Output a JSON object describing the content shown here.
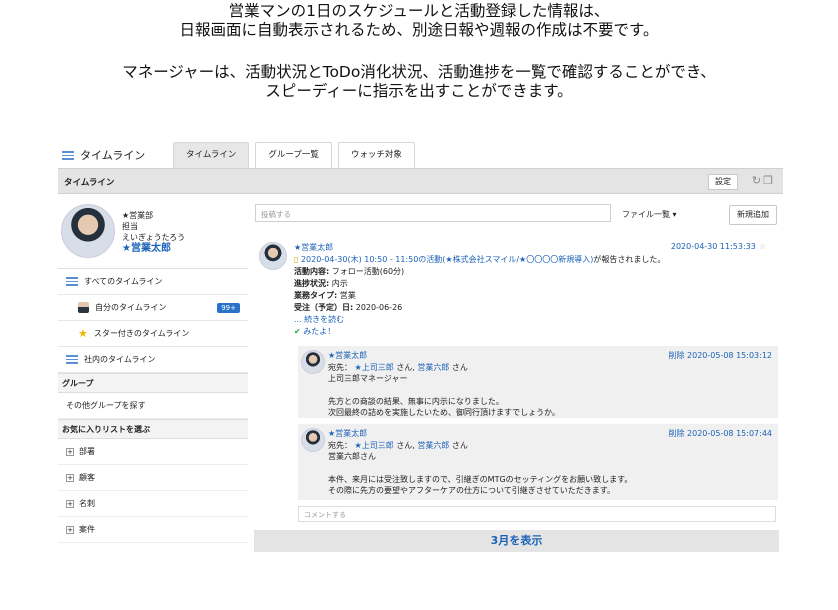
{
  "caption": {
    "line1": "営業マンの1日のスケジュールと活動登録した情報は、",
    "line2": "日報画面に自動表示されるため、別途日報や週報の作成は不要です。",
    "line3": "マネージャーは、活動状況とToDo消化状況、活動進捗を一覧で確認することができ、",
    "line4": "スピーディーに指示を出すことができます。"
  },
  "app": {
    "brand": "タイムライン",
    "tabs": [
      "タイムライン",
      "グループ一覧",
      "ウォッチ対象"
    ],
    "subbar_title": "タイムライン",
    "settings_label": "設定"
  },
  "profile": {
    "dept": "★営業部",
    "role": "担当",
    "kana": "えいぎょうたろう",
    "name": "★営業太郎"
  },
  "nav": {
    "all": "すべてのタイムライン",
    "mine": "自分のタイムライン",
    "mine_badge": "99+",
    "starred": "スター付きのタイムライン",
    "company": "社内のタイムライン"
  },
  "groups": {
    "header": "グループ",
    "find": "その他グループを探す"
  },
  "favorites": {
    "header": "お気に入りリストを選ぶ",
    "items": [
      "部署",
      "顧客",
      "名刺",
      "案件"
    ]
  },
  "main": {
    "post_placeholder": "投稿する",
    "file_list": "ファイル一覧 ▾",
    "new_button": "新規追加",
    "entry": {
      "author": "★営業太郎",
      "timestamp": "2020-04-30 11:53:33",
      "activity_line": "2020-04-30(木) 10:50 - 11:50の活動(★株式会社スマイル/★〇〇〇〇新規導入)",
      "activity_suffix": "が報告されました。",
      "content_label": "活動内容:",
      "content_value": "フォロー活動(60分)",
      "progress_label": "進捗状況:",
      "progress_value": "内示",
      "type_label": "業務タイプ:",
      "type_value": "営業",
      "order_label": "受注（予定）日:",
      "order_value": "2020-06-26",
      "read_more": "... 続きを読む",
      "like": "みたよ！"
    },
    "comments": [
      {
        "author": "★営業太郎",
        "to_label": "宛先：",
        "to1": "★上司三郎",
        "to_mid": "さん,",
        "to2": "営業六郎",
        "to_end": "さん",
        "addressee": "上司三郎マネージャー",
        "line1": "先方との商談の結果、無事に内示になりました。",
        "line2": "次回最終の詰めを実施したいため、御同行頂けますでしょうか。",
        "delete": "削除",
        "time": "2020-05-08 15:03:12"
      },
      {
        "author": "★営業太郎",
        "to_label": "宛先：",
        "to1": "★上司三郎",
        "to_mid": "さん,",
        "to2": "営業六郎",
        "to_end": "さん",
        "addressee": "営業六郎さん",
        "line1": "本件、来月には受注致しますので、引継ぎのMTGのセッティングをお願い致します。",
        "line2": "その際に先方の要望やアフターケアの仕方について引継ぎさせていただきます。",
        "delete": "削除",
        "time": "2020-05-08 15:07:44"
      }
    ],
    "comment_placeholder": "コメントする",
    "show_more": "3月を表示"
  }
}
